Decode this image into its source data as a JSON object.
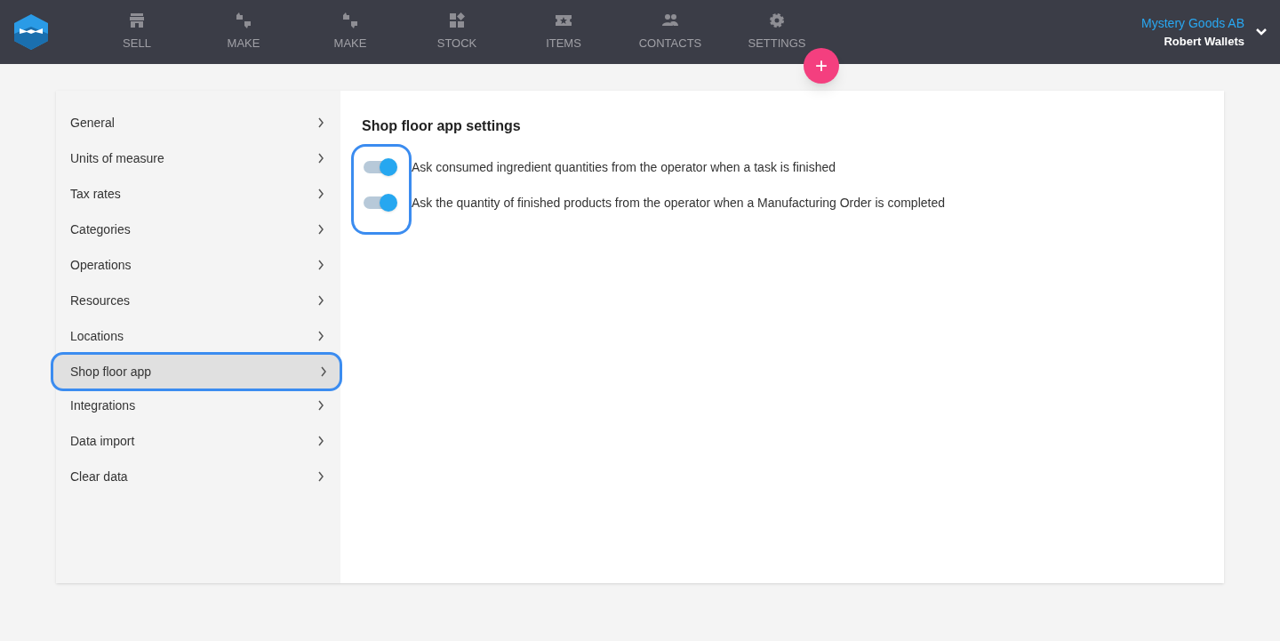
{
  "nav": [
    {
      "label": "SELL",
      "kind": "shop"
    },
    {
      "label": "MAKE",
      "kind": "thumbs"
    },
    {
      "label": "MAKE",
      "kind": "thumbs"
    },
    {
      "label": "STOCK",
      "kind": "blocks"
    },
    {
      "label": "ITEMS",
      "kind": "ticket"
    },
    {
      "label": "CONTACTS",
      "kind": "people"
    },
    {
      "label": "SETTINGS",
      "kind": "gear"
    }
  ],
  "fab": "+",
  "account": {
    "company": "Mystery Goods AB",
    "user": "Robert Wallets"
  },
  "sidebar": {
    "items": [
      {
        "label": "General",
        "selected": false
      },
      {
        "label": "Units of measure",
        "selected": false
      },
      {
        "label": "Tax rates",
        "selected": false
      },
      {
        "label": "Categories",
        "selected": false
      },
      {
        "label": "Operations",
        "selected": false
      },
      {
        "label": "Resources",
        "selected": false
      },
      {
        "label": "Locations",
        "selected": false
      },
      {
        "label": "Shop floor app",
        "selected": true
      },
      {
        "label": "Integrations",
        "selected": false
      },
      {
        "label": "Data import",
        "selected": false
      },
      {
        "label": "Clear data",
        "selected": false
      }
    ]
  },
  "panel": {
    "title": "Shop floor app settings",
    "toggles": [
      {
        "label": "Ask consumed ingredient quantities from the operator when a task is finished",
        "on": true
      },
      {
        "label": "Ask the quantity of finished products from the operator when a Manufacturing Order is completed",
        "on": true
      }
    ]
  }
}
